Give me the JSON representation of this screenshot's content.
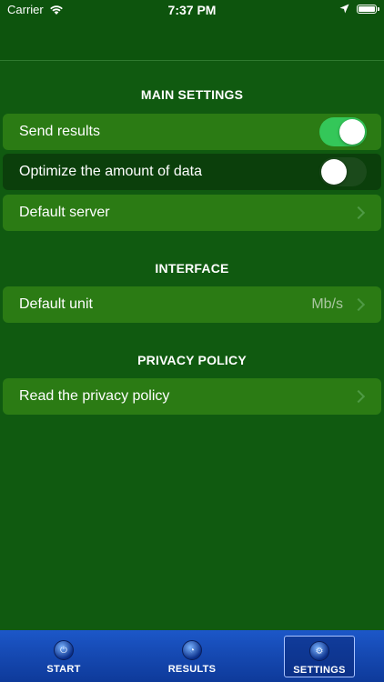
{
  "status_bar": {
    "carrier": "Carrier",
    "time": "7:37 PM"
  },
  "sections": {
    "main": {
      "title": "MAIN SETTINGS",
      "send_results": {
        "label": "Send results",
        "on": true
      },
      "optimize_data": {
        "label": "Optimize the amount of data",
        "on": false
      },
      "default_server": {
        "label": "Default server"
      }
    },
    "interface": {
      "title": "INTERFACE",
      "default_unit": {
        "label": "Default unit",
        "value": "Mb/s"
      }
    },
    "privacy": {
      "title": "PRIVACY POLICY",
      "read_policy": {
        "label": "Read the privacy policy"
      }
    }
  },
  "tabs": {
    "start": {
      "label": "START",
      "icon": "power-icon"
    },
    "results": {
      "label": "RESULTS",
      "icon": "results-icon"
    },
    "settings": {
      "label": "SETTINGS",
      "icon": "settings-icon",
      "active": true
    }
  },
  "colors": {
    "background": "#105a10",
    "row": "#2b7b14",
    "row_dark": "#0b3f0b",
    "toggle_on": "#34c759",
    "tab_bar": "#1c57c8"
  }
}
